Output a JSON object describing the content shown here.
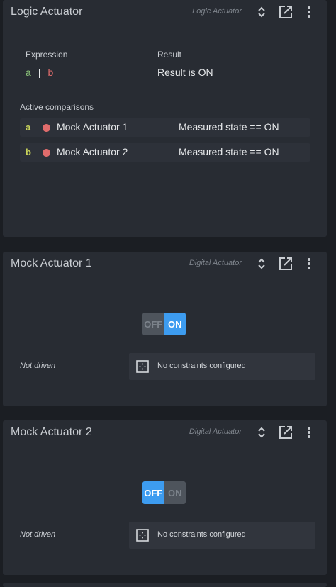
{
  "logic_card": {
    "title": "Logic Actuator",
    "type": "Logic Actuator",
    "expression_label": "Expression",
    "expression": {
      "a": "a",
      "sep": "|",
      "b": "b"
    },
    "result_label": "Result",
    "result_value": "Result is ON",
    "comparisons_label": "Active comparisons",
    "comparisons": [
      {
        "key": "a",
        "name": "Mock Actuator 1",
        "condition": "Measured state == ON"
      },
      {
        "key": "b",
        "name": "Mock Actuator 2",
        "condition": "Measured state == ON"
      }
    ]
  },
  "actuators": [
    {
      "title": "Mock Actuator 1",
      "type": "Digital Actuator",
      "toggle": {
        "off_label": "OFF",
        "on_label": "ON",
        "state": "ON"
      },
      "drive_status": "Not driven",
      "constraints": "No constraints configured"
    },
    {
      "title": "Mock Actuator 2",
      "type": "Digital Actuator",
      "toggle": {
        "off_label": "OFF",
        "on_label": "ON",
        "state": "OFF"
      },
      "drive_status": "Not driven",
      "constraints": "No constraints configured"
    }
  ],
  "icons": {
    "expand": "unfold-icon",
    "open": "open-in-new-icon",
    "menu": "more-vert-icon",
    "constraints": "dots-grid-icon"
  },
  "colors": {
    "toggle_active": "#3d9cf0",
    "status_dot": "#e06c6c",
    "expr_a": "#8cc37a",
    "key_letter": "#c7d25a"
  }
}
